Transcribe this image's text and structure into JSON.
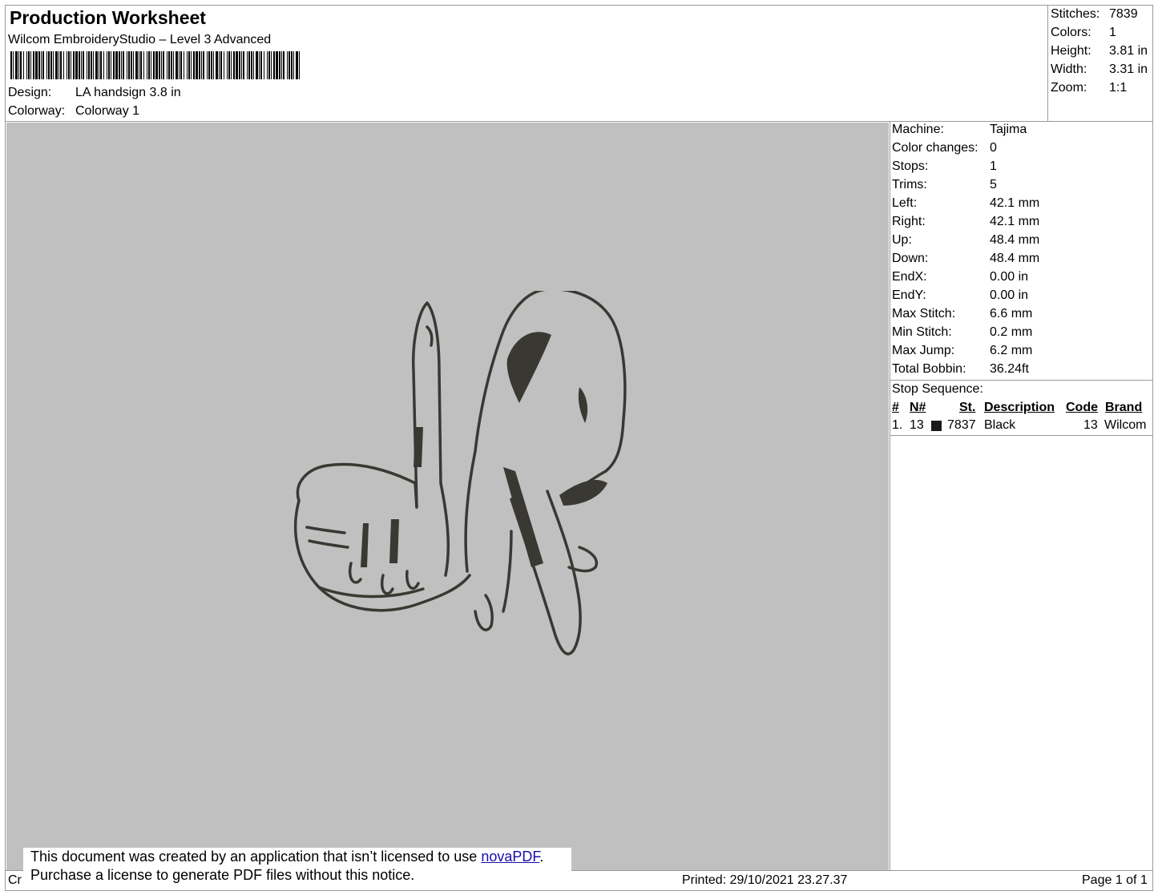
{
  "header": {
    "title": "Production Worksheet",
    "subtitle": "Wilcom EmbroideryStudio – Level 3 Advanced",
    "design_label": "Design:",
    "design_value": "LA handsign 3.8 in",
    "colorway_label": "Colorway:",
    "colorway_value": "Colorway 1"
  },
  "summary": [
    {
      "label": "Stitches:",
      "value": "7839"
    },
    {
      "label": "Colors:",
      "value": "1"
    },
    {
      "label": "Height:",
      "value": "3.81 in"
    },
    {
      "label": "Width:",
      "value": "3.31 in"
    },
    {
      "label": "Zoom:",
      "value": "1:1"
    }
  ],
  "stats": [
    {
      "label": "Machine:",
      "value": "Tajima"
    },
    {
      "label": "Color changes:",
      "value": "0"
    },
    {
      "label": "Stops:",
      "value": "1"
    },
    {
      "label": "Trims:",
      "value": "5"
    },
    {
      "label": "Left:",
      "value": "42.1 mm"
    },
    {
      "label": "Right:",
      "value": "42.1 mm"
    },
    {
      "label": "Up:",
      "value": "48.4 mm"
    },
    {
      "label": "Down:",
      "value": "48.4 mm"
    },
    {
      "label": "EndX:",
      "value": "0.00 in"
    },
    {
      "label": "EndY:",
      "value": "0.00 in"
    },
    {
      "label": "Max Stitch:",
      "value": "6.6 mm"
    },
    {
      "label": "Min Stitch:",
      "value": "0.2 mm"
    },
    {
      "label": "Max Jump:",
      "value": "6.2 mm"
    },
    {
      "label": "Total Bobbin:",
      "value": "36.24ft"
    }
  ],
  "stop_sequence": {
    "title": "Stop Sequence:",
    "headers": {
      "num": "#",
      "needle": "N#",
      "stitches": "St.",
      "description": "Description",
      "code": "Code",
      "brand": "Brand"
    },
    "rows": [
      {
        "num": "1.",
        "needle": "13",
        "swatch_color": "#1a1a1a",
        "stitches": "7837",
        "description": "Black",
        "code": "13",
        "brand": "Wilcom"
      }
    ]
  },
  "design_thread_color": "#3a3832",
  "canvas_color": "#c0c0c0",
  "notice": {
    "line1_prefix": "This document was created by an application that isn’t licensed to use ",
    "link_text": "novaPDF",
    "line1_suffix": ".",
    "line2": "Purchase a license to generate PDF files without this notice."
  },
  "footer": {
    "created_fragment": "Cr",
    "printed": "Printed: 29/10/2021 23.27.37",
    "page": "Page 1 of 1"
  }
}
